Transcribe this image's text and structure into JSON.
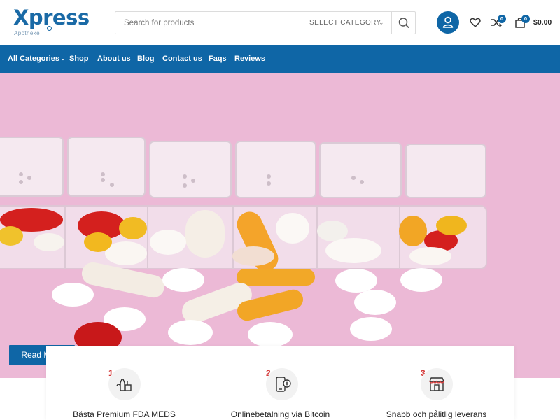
{
  "header": {
    "logo": {
      "name": "Xpress",
      "subtitle": "Apotheke"
    },
    "search": {
      "placeholder": "Search for products",
      "category": "SELECT CATEGORY"
    },
    "compare_count": "0",
    "cart_count": "0",
    "cart_total": "$0.00"
  },
  "nav": {
    "items": [
      {
        "label": "All Categories"
      },
      {
        "label": "Shop"
      },
      {
        "label": "About us"
      },
      {
        "label": "Blog"
      },
      {
        "label": "Contact us"
      },
      {
        "label": "Faqs"
      },
      {
        "label": "Reviews"
      }
    ]
  },
  "hero": {
    "button_label": "Read More"
  },
  "features": [
    {
      "number": "1.",
      "title": "Bästa Premium FDA MEDS",
      "icon": "bottles-icon"
    },
    {
      "number": "2.",
      "title": "Onlinebetalning via Bitcoin",
      "icon": "mobile-payment-icon"
    },
    {
      "number": "3.",
      "title": "Snabb och pålitlig leverans",
      "icon": "storefront-icon"
    }
  ],
  "colors": {
    "brand": "#0f66a6",
    "hero_bg": "#ecb9d6",
    "accent_number": "#d43a3a"
  }
}
